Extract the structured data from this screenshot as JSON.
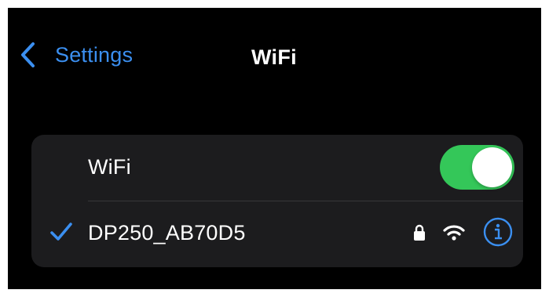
{
  "nav": {
    "back_label": "Settings",
    "title": "WiFi"
  },
  "wifi_row": {
    "label": "WiFi",
    "toggle_on": true
  },
  "network": {
    "name": "DP250_AB70D5",
    "selected": true,
    "secured": true,
    "icons": [
      "checkmark-icon",
      "lock-icon",
      "wifi-signal-icon",
      "info-icon"
    ]
  },
  "colors": {
    "accent": "#3b8ff0",
    "toggle_on": "#34c759",
    "background": "#000000",
    "group_background": "#1c1c1e"
  }
}
